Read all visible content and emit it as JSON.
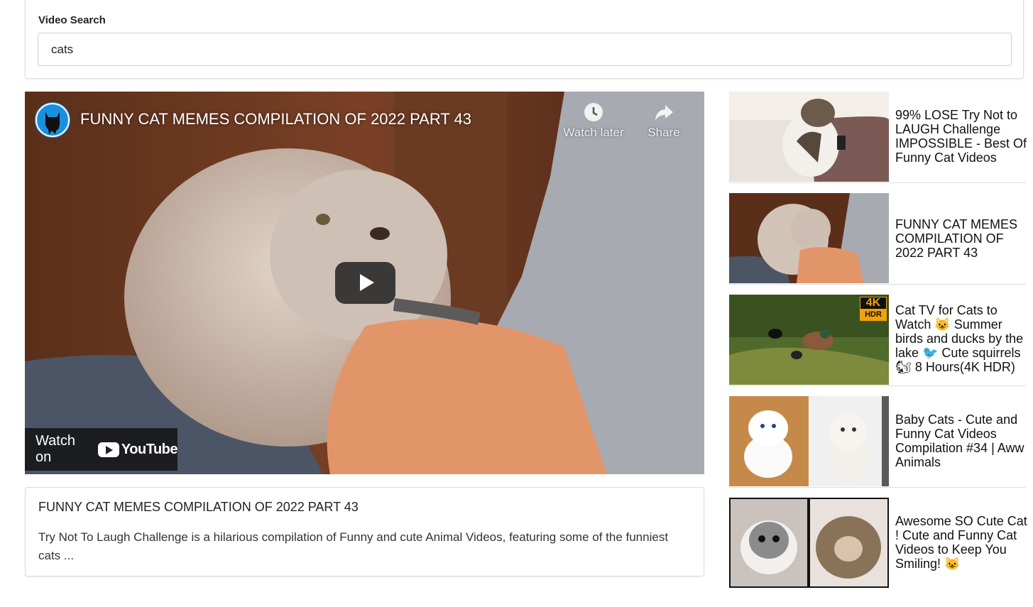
{
  "search": {
    "label": "Video Search",
    "value": "cats"
  },
  "player": {
    "title": "FUNNY CAT MEMES COMPILATION OF 2022 PART 43",
    "watch_later": "Watch later",
    "share": "Share",
    "watch_on": "Watch on",
    "youtube_brand": "YouTube"
  },
  "detail": {
    "title": "FUNNY CAT MEMES COMPILATION OF 2022 PART 43",
    "description": "Try Not To Laugh Challenge is a hilarious compilation of Funny and cute Animal Videos, featuring some of the funniest cats ..."
  },
  "results": [
    {
      "title": "99% LOSE Try Not to LAUGH Challenge IMPOSSIBLE - Best Of Funny Cat Videos"
    },
    {
      "title": "FUNNY CAT MEMES COMPILATION OF 2022 PART 43"
    },
    {
      "title": "Cat TV for Cats to Watch 😺 Summer birds and ducks by the lake 🐦 Cute squirrels 🐿 8 Hours(4K HDR)",
      "badge_top": "4K",
      "badge_bottom": "HDR"
    },
    {
      "title": "Baby Cats - Cute and Funny Cat Videos Compilation #34 | Aww Animals"
    },
    {
      "title": "Awesome SO Cute Cat ! Cute and Funny Cat Videos to Keep You Smiling! 😺"
    }
  ],
  "icons": {
    "clock": "clock-icon",
    "share": "share-icon",
    "play": "play-icon"
  }
}
